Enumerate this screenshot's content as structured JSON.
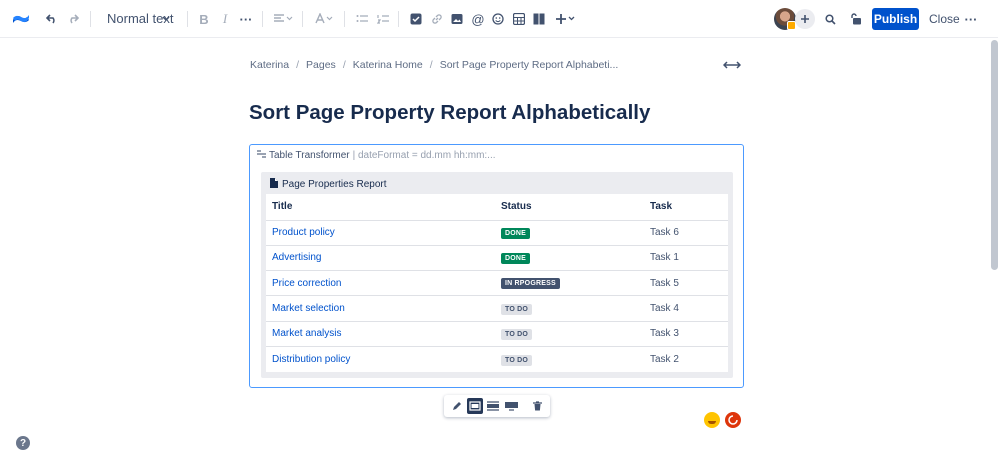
{
  "toolbar": {
    "text_style": "Normal text",
    "publish_label": "Publish",
    "close_label": "Close"
  },
  "breadcrumb": [
    "Katerina",
    "Pages",
    "Katerina Home",
    "Sort Page Property Report Alphabeti..."
  ],
  "page": {
    "title": "Sort Page Property Report Alphabetically"
  },
  "macro": {
    "name": "Table Transformer",
    "params": "| dateFormat = dd.mm hh:mm:...",
    "report_title": "Page Properties Report",
    "columns": [
      "Title",
      "Status",
      "Task"
    ],
    "rows": [
      {
        "title": "Product policy",
        "status": "DONE",
        "task": "Task 6"
      },
      {
        "title": "Advertising",
        "status": "DONE",
        "task": "Task 1"
      },
      {
        "title": "Price correction",
        "status": "IN RPOGRESS",
        "task": "Task 5"
      },
      {
        "title": "Market selection",
        "status": "TO DO",
        "task": "Task 4"
      },
      {
        "title": "Market analysis",
        "status": "TO DO",
        "task": "Task 3"
      },
      {
        "title": "Distribution policy",
        "status": "TO DO",
        "task": "Task 2"
      }
    ]
  },
  "help_label": "?",
  "colors": {
    "primary": "#0052cc",
    "done": "#00875a",
    "in_progress": "#42526e",
    "todo": "#dfe1e6",
    "selection_border": "#4c9aff"
  },
  "icons": [
    "confluence-logo-icon",
    "undo-icon",
    "redo-icon",
    "bold-icon",
    "italic-icon",
    "more-formatting-icon",
    "align-icon",
    "text-color-icon",
    "bullet-list-icon",
    "numbered-list-icon",
    "task-icon",
    "link-icon",
    "image-icon",
    "mention-icon",
    "emoji-icon",
    "table-icon",
    "layout-icon",
    "insert-icon",
    "search-icon",
    "restrictions-icon",
    "more-icon",
    "expand-width-icon",
    "edit-icon",
    "trash-icon",
    "help-icon"
  ]
}
